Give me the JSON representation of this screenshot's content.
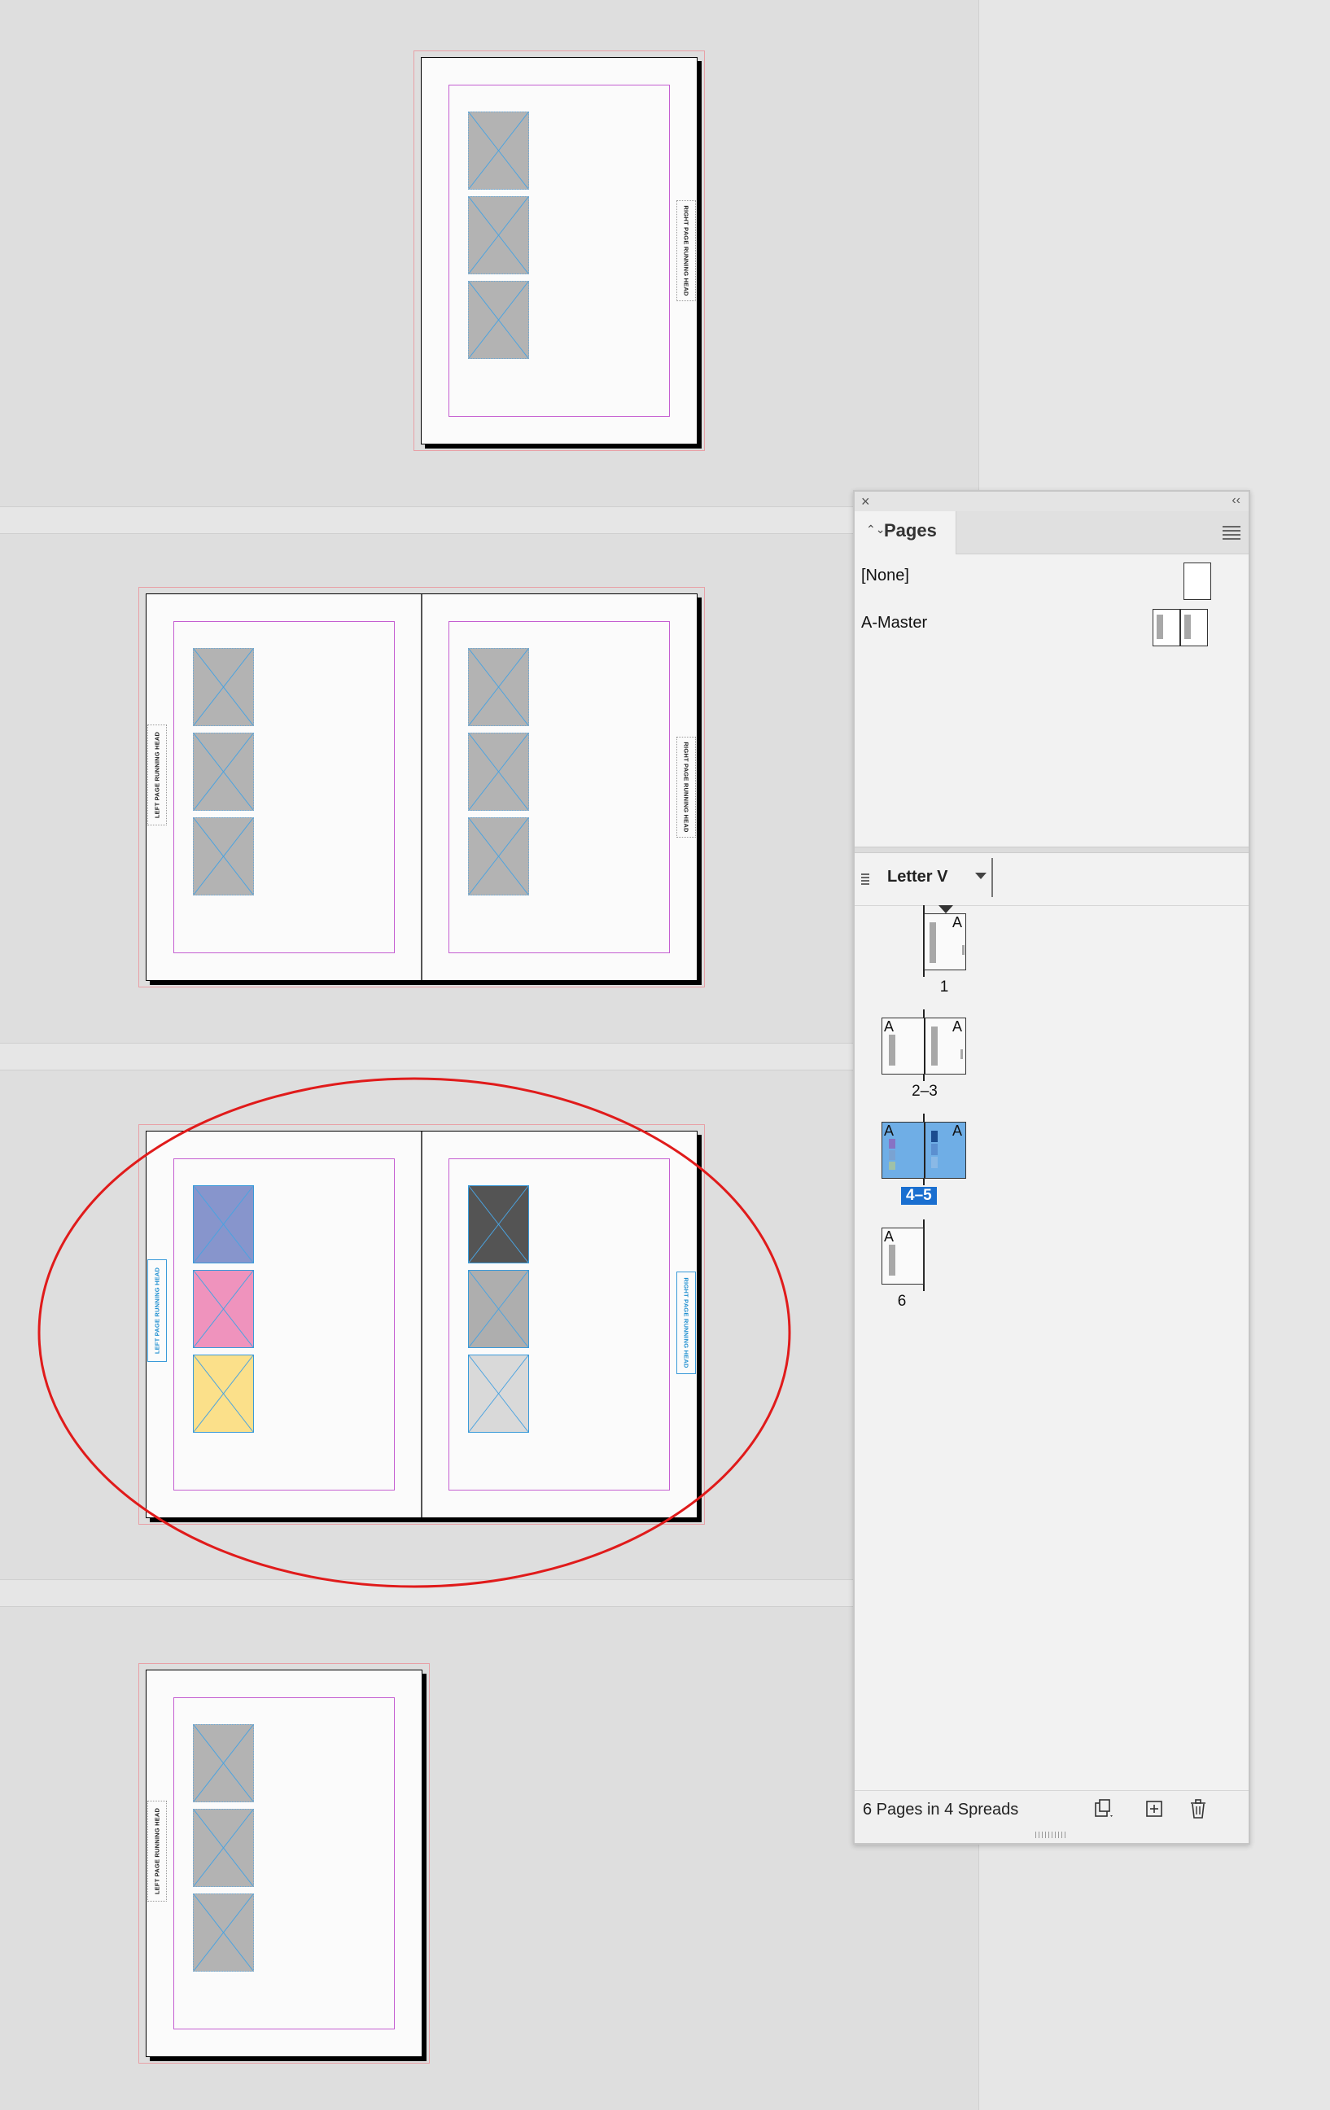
{
  "document": {
    "spreads": [
      {
        "name": "spread-1",
        "pages": [
          "1"
        ]
      },
      {
        "name": "spread-2-3",
        "pages": [
          "2",
          "3"
        ]
      },
      {
        "name": "spread-4-5",
        "pages": [
          "4",
          "5"
        ],
        "selected": true
      },
      {
        "name": "spread-6",
        "pages": [
          "6"
        ]
      }
    ],
    "running_head_right": "RIGHT PAGE RUNNING HEAD",
    "running_head_left": "LEFT PAGE RUNNING HEAD",
    "frame_fill_colors": {
      "default": "#b3b3b3",
      "blue": "#8795cc",
      "pink": "#ef93bd",
      "yellow": "#fbe08a",
      "dark": "#545454",
      "mid": "#aeaeae",
      "light": "#d9d9d9"
    },
    "annotation_color": "#e01b1b"
  },
  "pages_panel": {
    "tab_label": "Pages",
    "masters": [
      {
        "label": "[None]"
      },
      {
        "label": "A-Master"
      }
    ],
    "page_size": "Letter V",
    "thumbnails": [
      {
        "label": "1"
      },
      {
        "label": "2–3"
      },
      {
        "label": "4–5",
        "selected": true
      },
      {
        "label": "6"
      }
    ],
    "master_prefix": "A",
    "footer_text": "6 Pages in 4 Spreads",
    "icons": [
      "close-icon",
      "collapse-icon",
      "panel-menu-icon",
      "edit-page-size-icon",
      "new-page-icon",
      "delete-page-icon"
    ]
  }
}
